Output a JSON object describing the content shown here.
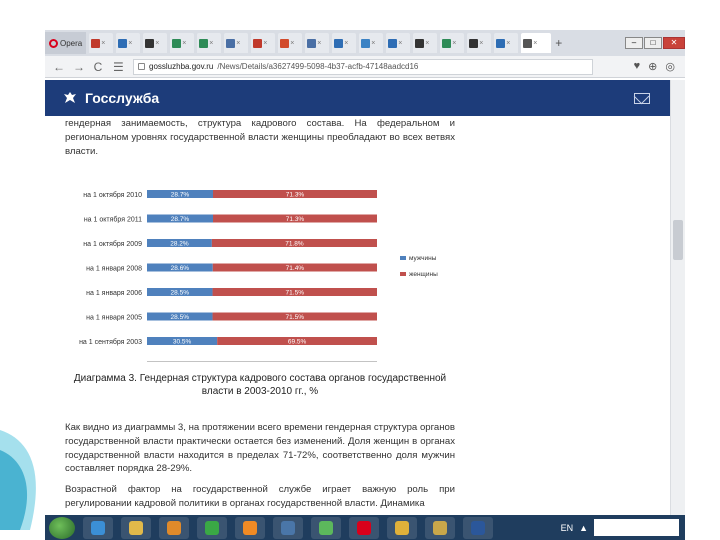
{
  "browser": {
    "opera_label": "Opera",
    "tabs": [
      {
        "color": "#c0392b"
      },
      {
        "color": "#2e6db4"
      },
      {
        "color": "#333333"
      },
      {
        "color": "#2e8b57"
      },
      {
        "color": "#2e8b57"
      },
      {
        "color": "#4a6fa5"
      },
      {
        "color": "#c0392b"
      },
      {
        "color": "#d24a2b"
      },
      {
        "color": "#4a6fa5"
      },
      {
        "color": "#2e6db4"
      },
      {
        "color": "#3b82c4"
      },
      {
        "color": "#2e6db4"
      },
      {
        "color": "#333333"
      },
      {
        "color": "#2e8b57"
      },
      {
        "color": "#333333"
      },
      {
        "color": "#2e6db4"
      },
      {
        "color": "#555555",
        "active": true
      }
    ],
    "url_domain": "gossluzhba.gov.ru",
    "url_path": "/News/Details/a3627499-5098-4b37-acfb-47148aadcd16"
  },
  "site": {
    "brand": "Госслужба",
    "brand_color": "#1d3c7a"
  },
  "article": {
    "intro": "гендерная занимаемость, структура кадрового состава. На федеральном и региональном уровнях государственной власти женщины преобладают во всех ветвях власти.",
    "caption": "Диаграмма 3. Гендерная структура кадрового состава органов государственной власти в 2003-2010 гг., %",
    "para2": "Как видно из диаграммы 3, на протяжении всего времени гендерная структура органов государственной власти практически остается без изменений. Доля женщин в органах государственной власти находится в пределах 71-72%, соответственно доля мужчин составляет порядка 28-29%.",
    "para3": "Возрастной фактор на государственной службе играет важную роль при регулировании кадровой политики в органах государственной власти. Динамика"
  },
  "chart_data": {
    "type": "bar",
    "stacked": true,
    "orientation": "horizontal",
    "categories": [
      "на 1 октября 2010",
      "на 1 октября 2011",
      "на 1 октября 2009",
      "на 1 января 2008",
      "на 1 января 2006",
      "на 1 января 2005",
      "на 1 сентября 2003"
    ],
    "series": [
      {
        "name": "мужчины",
        "color": "#4f81bd",
        "values": [
          28.7,
          28.7,
          28.2,
          28.6,
          28.5,
          28.5,
          30.5
        ]
      },
      {
        "name": "женщины",
        "color": "#c0504d",
        "values": [
          71.3,
          71.3,
          71.8,
          71.4,
          71.5,
          71.5,
          69.5
        ]
      }
    ],
    "value_labels": [
      [
        "28.7%",
        "71.3%"
      ],
      [
        "28.7%",
        "71.3%"
      ],
      [
        "28.2%",
        "71.8%"
      ],
      [
        "28.6%",
        "71.4%"
      ],
      [
        "28.5%",
        "71.5%"
      ],
      [
        "28.5%",
        "71.5%"
      ],
      [
        "30.5%",
        "69.5%"
      ]
    ],
    "x_ticks": [
      "0%",
      "20%",
      "40%",
      "60%",
      "80%",
      "100%"
    ],
    "xlim": [
      0,
      100
    ],
    "legend_position": "right",
    "grid": false
  },
  "taskbar": {
    "apps": [
      {
        "name": "ie",
        "color": "#3b8fd6"
      },
      {
        "name": "explorer",
        "color": "#e1b94a"
      },
      {
        "name": "media",
        "color": "#e08a2a"
      },
      {
        "name": "aimp",
        "color": "#3aa845"
      },
      {
        "name": "odnoklassniki",
        "color": "#f08a24"
      },
      {
        "name": "vk",
        "color": "#4a76a8"
      },
      {
        "name": "icq",
        "color": "#5cb85c"
      },
      {
        "name": "opera",
        "color": "#d9001b"
      },
      {
        "name": "chrome",
        "color": "#e0b13a"
      },
      {
        "name": "paint",
        "color": "#c9a74a"
      },
      {
        "name": "word",
        "color": "#2b579a"
      }
    ],
    "lang": "EN"
  }
}
